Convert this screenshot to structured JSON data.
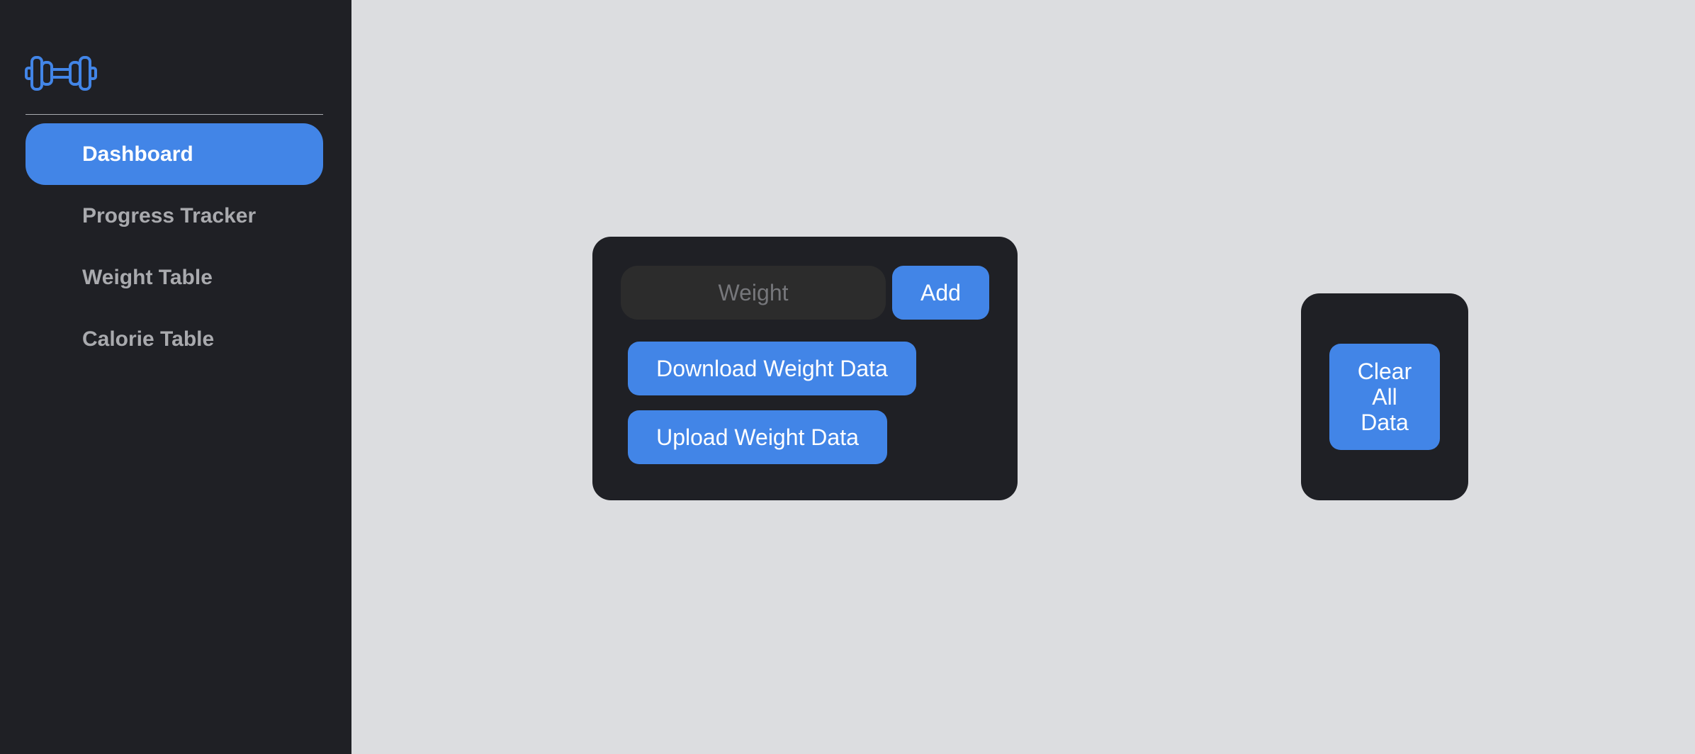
{
  "sidebar": {
    "logo_icon": "dumbbell-icon",
    "items": [
      {
        "label": "Dashboard",
        "active": true
      },
      {
        "label": "Progress Tracker",
        "active": false
      },
      {
        "label": "Weight Table",
        "active": false
      },
      {
        "label": "Calorie Table",
        "active": false
      }
    ]
  },
  "weight_card": {
    "weight_placeholder": "Weight",
    "weight_value": "",
    "add_label": "Add",
    "download_label": "Download Weight Data",
    "upload_label": "Upload Weight Data"
  },
  "clear_card": {
    "clear_label": "Clear All Data"
  },
  "colors": {
    "accent": "#4285e7",
    "sidebar_bg": "#1f2025",
    "page_bg": "#dcdde0",
    "input_bg": "#2c2c2c",
    "inactive_text": "#a9aaae"
  }
}
